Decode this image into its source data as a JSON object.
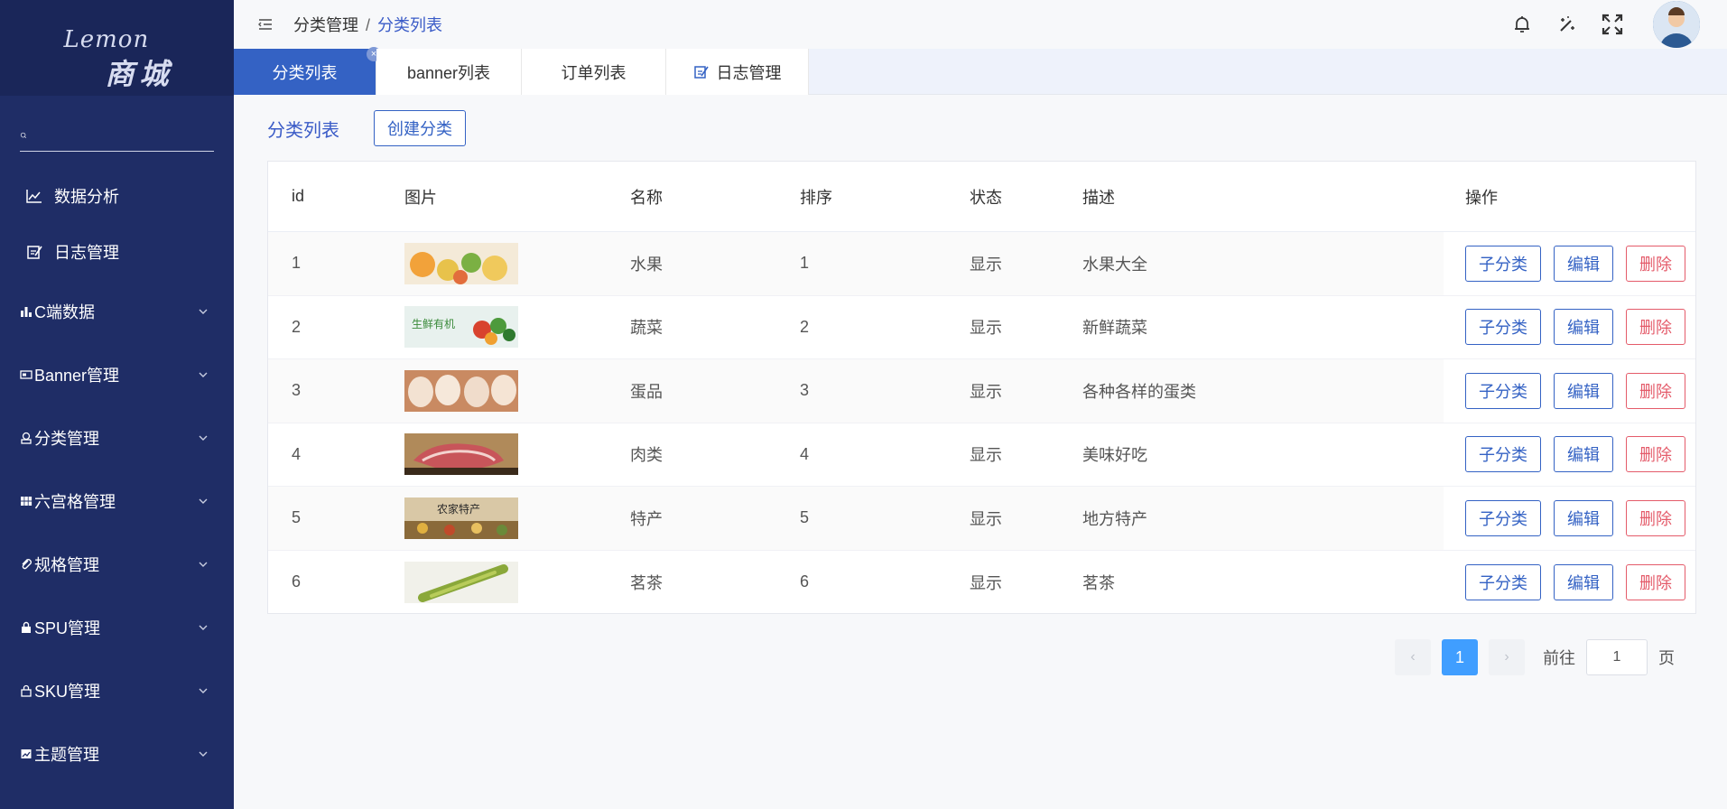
{
  "app": {
    "logo_top": "Lemon",
    "logo_bottom": "商城"
  },
  "sidebar": {
    "search_placeholder": "",
    "simple_items": [
      {
        "label": "数据分析",
        "icon": "line-chart-icon"
      },
      {
        "label": "日志管理",
        "icon": "edit-note-icon"
      }
    ],
    "groups": [
      {
        "label": "C端数据",
        "icon": "bar-chart-icon"
      },
      {
        "label": "Banner管理",
        "icon": "banner-icon"
      },
      {
        "label": "分类管理",
        "icon": "category-icon"
      },
      {
        "label": "六宫格管理",
        "icon": "grid-icon"
      },
      {
        "label": "规格管理",
        "icon": "paperclip-icon"
      },
      {
        "label": "SPU管理",
        "icon": "lock-bag-icon"
      },
      {
        "label": "SKU管理",
        "icon": "bag-icon"
      },
      {
        "label": "主题管理",
        "icon": "theme-icon"
      }
    ]
  },
  "header": {
    "breadcrumb_parent": "分类管理",
    "breadcrumb_sep": "/",
    "breadcrumb_current": "分类列表"
  },
  "tabs": [
    {
      "label": "分类列表",
      "active": true,
      "close": "×"
    },
    {
      "label": "banner列表",
      "active": false
    },
    {
      "label": "订单列表",
      "active": false
    },
    {
      "label": "日志管理",
      "active": false,
      "icon": "edit-note-icon"
    }
  ],
  "page": {
    "title": "分类列表",
    "create_label": "创建分类"
  },
  "table": {
    "columns": [
      "id",
      "图片",
      "名称",
      "排序",
      "状态",
      "描述",
      "操作"
    ],
    "rows": [
      {
        "id": "1",
        "name": "水果",
        "sort": "1",
        "status": "显示",
        "desc": "水果大全",
        "img": "fruit"
      },
      {
        "id": "2",
        "name": "蔬菜",
        "sort": "2",
        "status": "显示",
        "desc": "新鲜蔬菜",
        "img": "vegetable",
        "img_text": "生鲜有机"
      },
      {
        "id": "3",
        "name": "蛋品",
        "sort": "3",
        "status": "显示",
        "desc": "各种各样的蛋类",
        "img": "egg"
      },
      {
        "id": "4",
        "name": "肉类",
        "sort": "4",
        "status": "显示",
        "desc": "美味好吃",
        "img": "meat"
      },
      {
        "id": "5",
        "name": "特产",
        "sort": "5",
        "status": "显示",
        "desc": "地方特产",
        "img": "specialty",
        "img_text": "农家特产"
      },
      {
        "id": "6",
        "name": "茗茶",
        "sort": "6",
        "status": "显示",
        "desc": "茗茶",
        "img": "tea"
      }
    ],
    "actions": {
      "sub": "子分类",
      "edit": "编辑",
      "delete": "删除"
    }
  },
  "pagination": {
    "prev": "‹",
    "next": "›",
    "current_page": "1",
    "goto_label": "前往",
    "goto_value": "1",
    "page_unit": "页"
  },
  "colors": {
    "sidebar_bg": "#1f2d66",
    "primary": "#3462c4",
    "danger": "#e45b6a",
    "page_active": "#409eff"
  }
}
